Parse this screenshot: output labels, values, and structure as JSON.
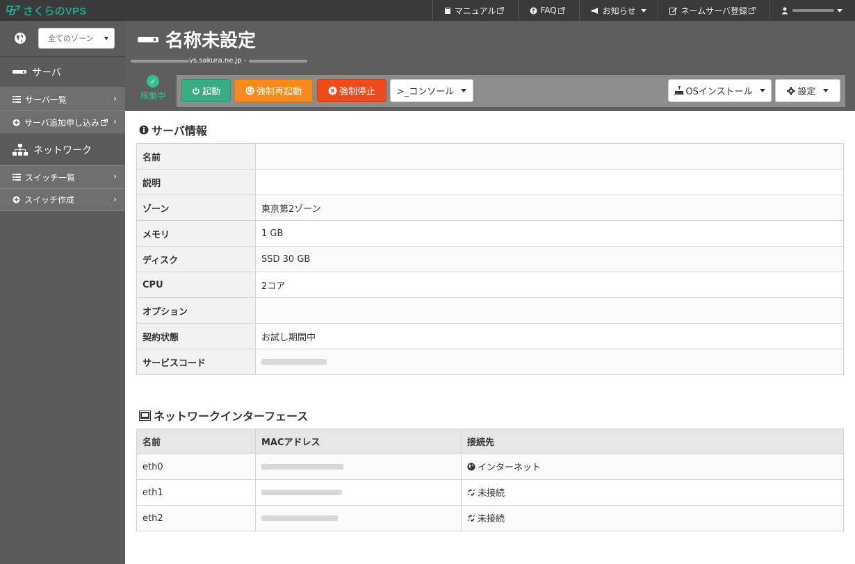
{
  "app": {
    "logo_text": "さくらのVPS",
    "brand_color": "#1ea58c"
  },
  "topnav": {
    "manual": "マニュアル",
    "faq": "FAQ",
    "news": "お知らせ",
    "nameserver": "ネームサーバ登録"
  },
  "sidebar": {
    "zone_select": "全てのゾーン",
    "server_section": "サーバ",
    "server_list": "サーバ一覧",
    "server_add": "サーバ追加申し込み",
    "network_section": "ネットワーク",
    "switch_list": "スイッチ一覧",
    "switch_create": "スイッチ作成"
  },
  "header": {
    "title": "名称未設定",
    "host_suffix": "vs.sakura.ne.jp -",
    "status": "稼働中",
    "status_color": "#2fc38f"
  },
  "toolbar": {
    "start": "起動",
    "force_restart": "強制再起動",
    "force_stop": "強制停止",
    "console": ">_コンソール",
    "os_install": "OSインストール",
    "settings": "設定"
  },
  "server_info": {
    "title": "サーバ情報",
    "rows": [
      {
        "label": "名前",
        "value": ""
      },
      {
        "label": "説明",
        "value": ""
      },
      {
        "label": "ゾーン",
        "value": "東京第2ゾーン"
      },
      {
        "label": "メモリ",
        "value": "1 GB"
      },
      {
        "label": "ディスク",
        "value": "SSD 30 GB"
      },
      {
        "label": "CPU",
        "value": "2コア"
      },
      {
        "label": "オプション",
        "value": ""
      },
      {
        "label": "契約状態",
        "value": "お試し期間中"
      },
      {
        "label": "サービスコード",
        "value": ""
      }
    ]
  },
  "network": {
    "title": "ネットワークインターフェース",
    "headers": [
      "名前",
      "MACアドレス",
      "接続先"
    ],
    "rows": [
      {
        "name": "eth0",
        "dest": "インターネット"
      },
      {
        "name": "eth1",
        "dest": "未接続"
      },
      {
        "name": "eth2",
        "dest": "未接続"
      }
    ]
  }
}
